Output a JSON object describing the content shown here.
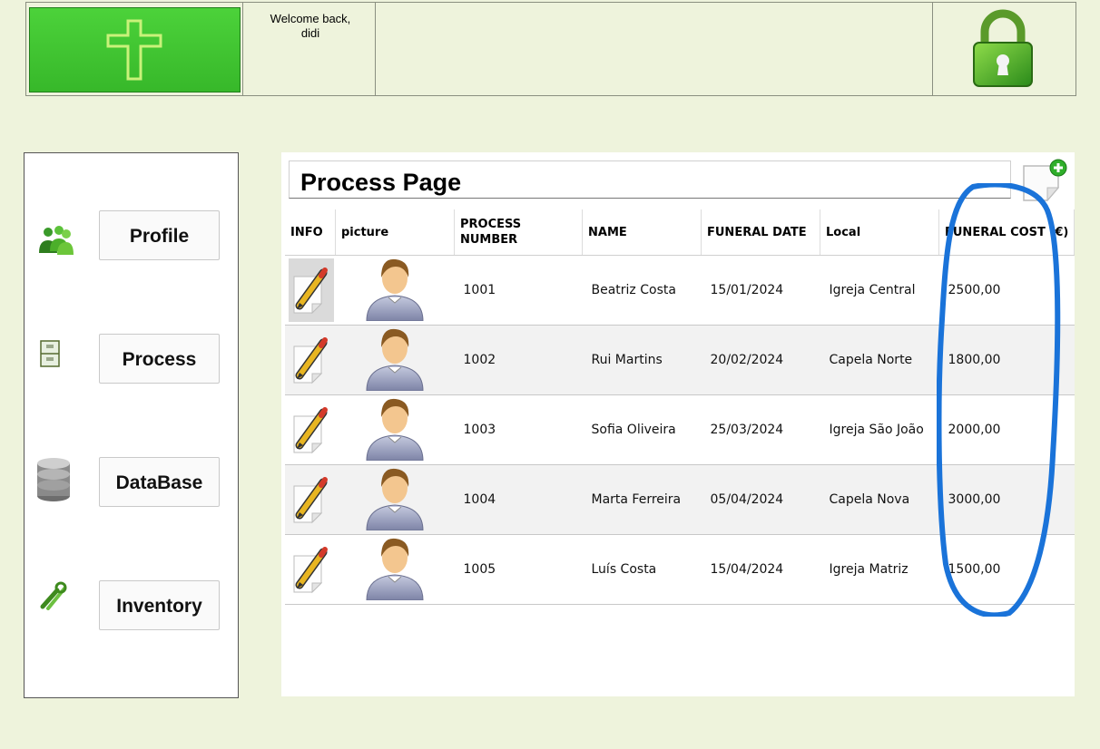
{
  "header": {
    "welcome": "Welcome back,\ndidi",
    "logo_icon": "cross-icon",
    "lock_icon": "lock-icon"
  },
  "sidebar": {
    "items": [
      {
        "label": "Profile",
        "icon": "users-icon"
      },
      {
        "label": "Process",
        "icon": "filing-cabinet-icon"
      },
      {
        "label": "DataBase",
        "icon": "database-icon"
      },
      {
        "label": "Inventory",
        "icon": "tools-icon"
      }
    ]
  },
  "main": {
    "title": "Process Page",
    "add_icon": "add-document-icon",
    "columns": [
      "INFO",
      "picture",
      "PROCESS NUMBER",
      "NAME",
      "FUNERAL DATE",
      "Local",
      "FUNERAL COST (€)"
    ],
    "rows": [
      {
        "process_number": "1001",
        "name": "Beatriz Costa",
        "date": "15/01/2024",
        "local": "Igreja Central",
        "cost": "2500,00"
      },
      {
        "process_number": "1002",
        "name": "Rui Martins",
        "date": "20/02/2024",
        "local": "Capela Norte",
        "cost": "1800,00"
      },
      {
        "process_number": "1003",
        "name": "Sofia Oliveira",
        "date": "25/03/2024",
        "local": "Igreja São João",
        "cost": "2000,00"
      },
      {
        "process_number": "1004",
        "name": "Marta Ferreira",
        "date": "05/04/2024",
        "local": "Capela Nova",
        "cost": "3000,00"
      },
      {
        "process_number": "1005",
        "name": "Luís Costa",
        "date": "15/04/2024",
        "local": "Igreja Matriz",
        "cost": "1500,00"
      }
    ]
  },
  "colors": {
    "background": "#eef3dc",
    "logo_green": "#3fc530",
    "annotation_blue": "#1a73d9"
  }
}
